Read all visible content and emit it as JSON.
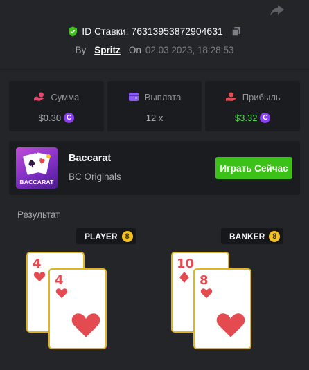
{
  "header": {
    "share_icon": "share-arrow-icon",
    "bet_id_label": "ID Ставки: 76313953872904631",
    "copy_icon": "copy-icon",
    "shield_icon": "shield-check-icon",
    "by_label": "By",
    "username": "Spritz",
    "on_label": "On",
    "date": "02.03.2023, 18:28:53"
  },
  "stats": [
    {
      "icon": "hand-coin-icon",
      "label": "Сумма",
      "value": "$0.30",
      "coin": true,
      "accent": "#a7aab0"
    },
    {
      "icon": "wallet-icon",
      "label": "Выплата",
      "value": "12 x",
      "coin": false,
      "accent": "#a7aab0"
    },
    {
      "icon": "profit-hand-icon",
      "label": "Прибыль",
      "value": "$3.32",
      "coin": true,
      "accent": "#4ed44f"
    }
  ],
  "coin_symbol": "C",
  "game": {
    "title": "Baccarat",
    "subtitle": "BC Originals",
    "thumb_label": "BACCARAT",
    "play_button": "Играть Сейчас"
  },
  "result": {
    "label": "Результат",
    "player": {
      "label": "PLAYER",
      "score": "8",
      "cards": [
        {
          "rank": "4",
          "suit": "hearts"
        },
        {
          "rank": "4",
          "suit": "hearts"
        }
      ]
    },
    "banker": {
      "label": "BANKER",
      "score": "8",
      "cards": [
        {
          "rank": "10",
          "suit": "diamonds"
        },
        {
          "rank": "8",
          "suit": "hearts"
        }
      ]
    }
  },
  "colors": {
    "background": "#232528",
    "panel": "#1b1c1f",
    "accent_green": "#3bc117",
    "profit_green": "#4ed44f",
    "coin_purple": "#8a3ff2",
    "card_border": "#e3b422",
    "suit_red": "#e34b50",
    "badge_yellow": "#f2c125"
  }
}
